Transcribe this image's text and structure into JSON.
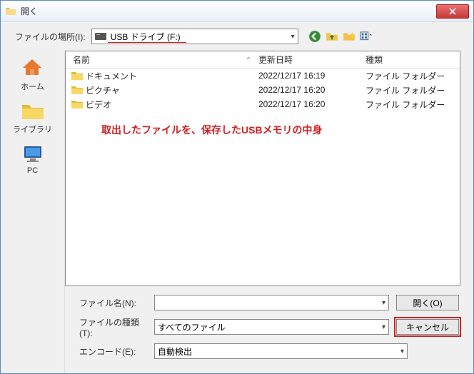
{
  "titlebar": {
    "title": "開く"
  },
  "toolbar": {
    "location_label": "ファイルの場所(I):",
    "location_value": "USB ドライブ (F:)"
  },
  "sidebar": {
    "items": [
      {
        "label": "ホーム"
      },
      {
        "label": "ライブラリ"
      },
      {
        "label": "PC"
      }
    ]
  },
  "columns": {
    "name": "名前",
    "date": "更新日時",
    "type": "種類"
  },
  "files": [
    {
      "name": "ドキュメント",
      "date": "2022/12/17 16:19",
      "type": "ファイル フォルダー"
    },
    {
      "name": "ピクチャ",
      "date": "2022/12/17 16:20",
      "type": "ファイル フォルダー"
    },
    {
      "name": "ビデオ",
      "date": "2022/12/17 16:20",
      "type": "ファイル フォルダー"
    }
  ],
  "annotation": "取出したファイルを、保存したUSBメモリの中身",
  "footer": {
    "filename_label": "ファイル名(N):",
    "filename_value": "",
    "filetype_label": "ファイルの種類(T):",
    "filetype_value": "すべてのファイル",
    "encoding_label": "エンコード(E):",
    "encoding_value": "自動検出",
    "open_button": "開く(O)",
    "cancel_button": "キャンセル"
  }
}
